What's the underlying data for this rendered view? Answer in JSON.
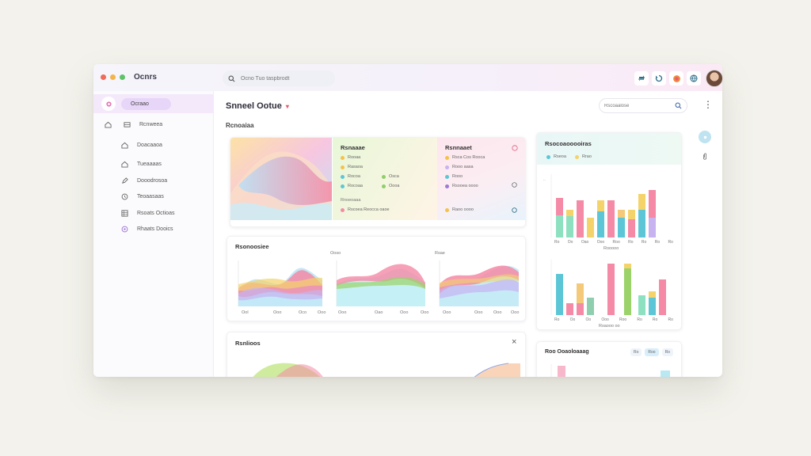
{
  "app": {
    "title": "Ocnrs",
    "search_placeholder": "Ocno Tuo taspbrodt",
    "window_dot_colors": [
      "#ef6b5a",
      "#f3b54a",
      "#5dc365"
    ]
  },
  "sidebar": {
    "items": [
      {
        "label": "Ocraao",
        "icon": "dashboard-icon",
        "active": true
      },
      {
        "label": "Rcnweea",
        "icon": "grid-icon"
      },
      {
        "label": "Doacaaoa",
        "icon": "home-icon"
      },
      {
        "label": "Tueaaaas",
        "icon": "home-icon"
      },
      {
        "label": "Dooodrosoa",
        "icon": "pen-icon"
      },
      {
        "label": "Teoaasaas",
        "icon": "clock-icon"
      },
      {
        "label": "Rsoats Octioas",
        "icon": "table-icon"
      },
      {
        "label": "Rhaats Dooics",
        "icon": "settings-icon"
      }
    ]
  },
  "header": {
    "title": "Snneel Ootue",
    "section_label": "Rcnoaiaa",
    "filter_placeholder": "Rscoaalose"
  },
  "hero_card": {
    "col1": {
      "title": "Rsnaaae",
      "items": [
        {
          "label": "Rooaa",
          "color": "#f4c24a"
        },
        {
          "label": "Rasaoa",
          "color": "#f4c24a"
        },
        {
          "label": "Rocoa",
          "color": "#5cc6d6"
        },
        {
          "label": "Rocoaa",
          "color": "#5cc6d6"
        }
      ],
      "items_b": [
        {
          "label": "Osca",
          "color": "#8fcf6a"
        },
        {
          "label": "Oooa",
          "color": "#8fcf6a"
        }
      ],
      "sub_label": "Rnoeoaaa",
      "footer": "Rscoea Reocca oaoe"
    },
    "col2": {
      "title": "Rsnnaaet",
      "items": [
        {
          "label": "Rsca Cos Rooca",
          "color": "#f4c24a"
        },
        {
          "label": "Rooo aasa",
          "color": "#c6b3ef"
        },
        {
          "label": "Rooo",
          "color": "#5cc6d6"
        },
        {
          "label": "Rsooea oooo",
          "color": "#9b7ad8"
        }
      ],
      "footer": "Raoo oooo"
    }
  },
  "waves_card": {
    "title": "Rsonoosiee",
    "sub1": "Ooso",
    "sub2": "Rsae",
    "x_labels_1": [
      "Ool",
      "Ooo",
      "Oco",
      "Ooo"
    ],
    "x_labels_2": [
      "Ooo",
      "Oao",
      "Ooo",
      "Ooo"
    ],
    "x_labels_3": [
      "Ooo",
      "Ooo",
      "Ooo",
      "Ooo"
    ]
  },
  "bottom_card": {
    "title": "Rsnlioos",
    "close": "×"
  },
  "bars_card": {
    "title": "Rsocoaooooiras",
    "legend": [
      {
        "label": "Rseoa",
        "color": "#5cc6d6"
      },
      {
        "label": "Rrao",
        "color": "#f4d36a"
      }
    ],
    "x_labels": [
      "Ro",
      "Oo",
      "Oao",
      "Ooo",
      "Roo",
      "Ro",
      "Ro",
      "Ro",
      "Ro"
    ],
    "sub_label": "Rooooo",
    "x_labels_2": [
      "Ro",
      "Oo",
      "Oo",
      "Ooo",
      "Roo",
      "Ro",
      "Ro",
      "Ro"
    ],
    "sub_label_2": "Rsaooo oo"
  },
  "bottom_right_card": {
    "title": "Roo Ooaoloaaag",
    "chips": [
      "Ro",
      "Roo",
      "Ro"
    ]
  }
}
